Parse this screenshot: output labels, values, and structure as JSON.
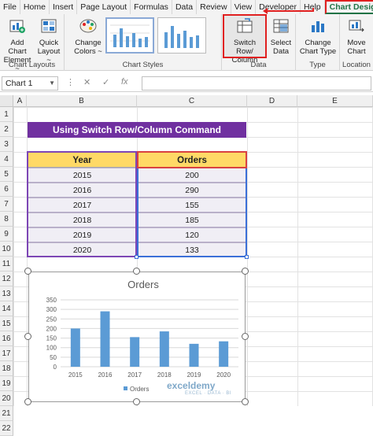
{
  "tabs": [
    "File",
    "Home",
    "Insert",
    "Page Layout",
    "Formulas",
    "Data",
    "Review",
    "View",
    "Developer",
    "Help",
    "Chart Design"
  ],
  "ribbon": {
    "add_chart_element": "Add Chart Element",
    "add_chart_element_l1": "Add Chart",
    "add_chart_element_l2": "Element ~",
    "quick_layout_l1": "Quick",
    "quick_layout_l2": "Layout ~",
    "chart_layouts_label": "Chart Layouts",
    "change_colors_l1": "Change",
    "change_colors_l2": "Colors ~",
    "chart_styles_label": "Chart Styles",
    "switch_row_col_l1": "Switch Row/",
    "switch_row_col_l2": "Column",
    "select_data_l1": "Select",
    "select_data_l2": "Data",
    "data_group_label": "Data",
    "change_chart_type_l1": "Change",
    "change_chart_type_l2": "Chart Type",
    "type_group_label": "Type",
    "move_chart_l1": "Move",
    "move_chart_l2": "Chart",
    "location_group_label": "Location"
  },
  "formula_bar": {
    "name_box": "Chart 1",
    "fx": "fx",
    "value": ""
  },
  "columns": [
    "A",
    "B",
    "C",
    "D",
    "E"
  ],
  "rows": [
    "1",
    "2",
    "3",
    "4",
    "5",
    "6",
    "7",
    "8",
    "9",
    "10",
    "11",
    "12",
    "13",
    "14",
    "15",
    "16",
    "17",
    "18",
    "19",
    "20",
    "21",
    "22"
  ],
  "banner": "Using Switch Row/Column Command",
  "table": {
    "headers": [
      "Year",
      "Orders"
    ],
    "rows": [
      [
        "2015",
        "200"
      ],
      [
        "2016",
        "290"
      ],
      [
        "2017",
        "155"
      ],
      [
        "2018",
        "185"
      ],
      [
        "2019",
        "120"
      ],
      [
        "2020",
        "133"
      ]
    ]
  },
  "watermark": {
    "name": "exceldemy",
    "tagline": "EXCEL · DATA · BI"
  },
  "chart_data": {
    "type": "bar",
    "title": "Orders",
    "categories": [
      "2015",
      "2016",
      "2017",
      "2018",
      "2019",
      "2020"
    ],
    "series": [
      {
        "name": "Orders",
        "values": [
          200,
          290,
          155,
          185,
          120,
          133
        ],
        "color": "#5b9bd5"
      }
    ],
    "ylim": [
      0,
      350
    ],
    "yticks": [
      "0",
      "50",
      "100",
      "150",
      "200",
      "250",
      "300",
      "350"
    ],
    "grid": true,
    "legend": "bottom"
  }
}
